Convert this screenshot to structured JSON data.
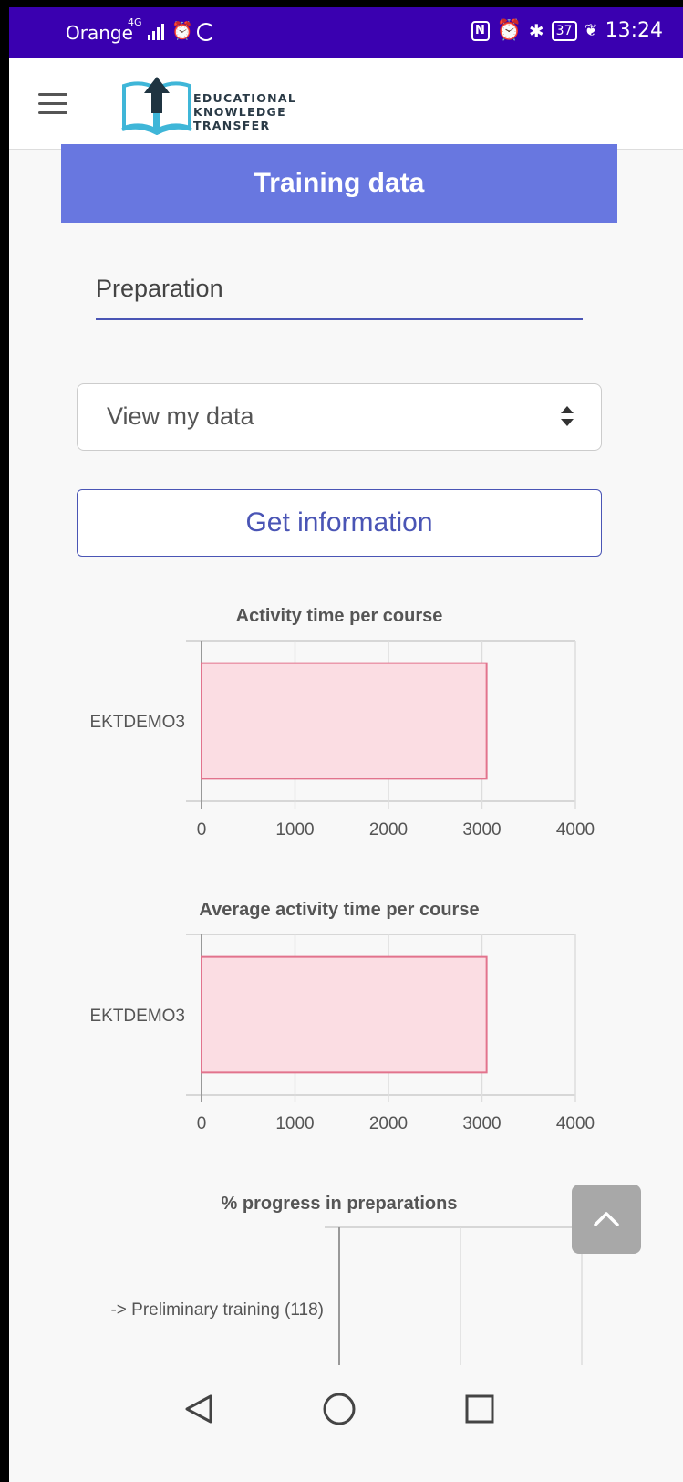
{
  "status_bar": {
    "carrier": "Orange",
    "network": "4G",
    "battery": "37",
    "time": "13:24"
  },
  "header": {
    "logo_lines": [
      "EDUCATIONAL",
      "KNOWLEDGE",
      "TRANSFER"
    ]
  },
  "page": {
    "title": "Training data",
    "preparation_value": "Preparation",
    "select_value": "View my data",
    "button_label": "Get information"
  },
  "colors": {
    "status_bar": "#3a00b0",
    "banner": "#6877e0",
    "accent": "#4a55b5",
    "bar_fill": "#fbdde3",
    "bar_stroke": "#e2738d"
  },
  "chart_data": [
    {
      "type": "bar",
      "orientation": "horizontal",
      "title": "Activity time per course",
      "categories": [
        "EKTDEMO3"
      ],
      "values": [
        3050
      ],
      "xlim": [
        0,
        4000
      ],
      "xticks": [
        "0",
        "1000",
        "2000",
        "3000",
        "4000"
      ],
      "grid": true
    },
    {
      "type": "bar",
      "orientation": "horizontal",
      "title": "Average activity time per course",
      "categories": [
        "EKTDEMO3"
      ],
      "values": [
        3050
      ],
      "xlim": [
        0,
        4000
      ],
      "xticks": [
        "0",
        "1000",
        "2000",
        "3000",
        "4000"
      ],
      "grid": true
    },
    {
      "type": "bar",
      "orientation": "horizontal",
      "title": "% progress in preparations",
      "categories": [
        "-> Preliminary training (118)"
      ],
      "grid": true
    }
  ],
  "icons": [
    "menu-icon",
    "logo-icon",
    "sort-arrows-icon",
    "chevron-up-icon",
    "back-icon",
    "home-icon",
    "recents-icon"
  ]
}
